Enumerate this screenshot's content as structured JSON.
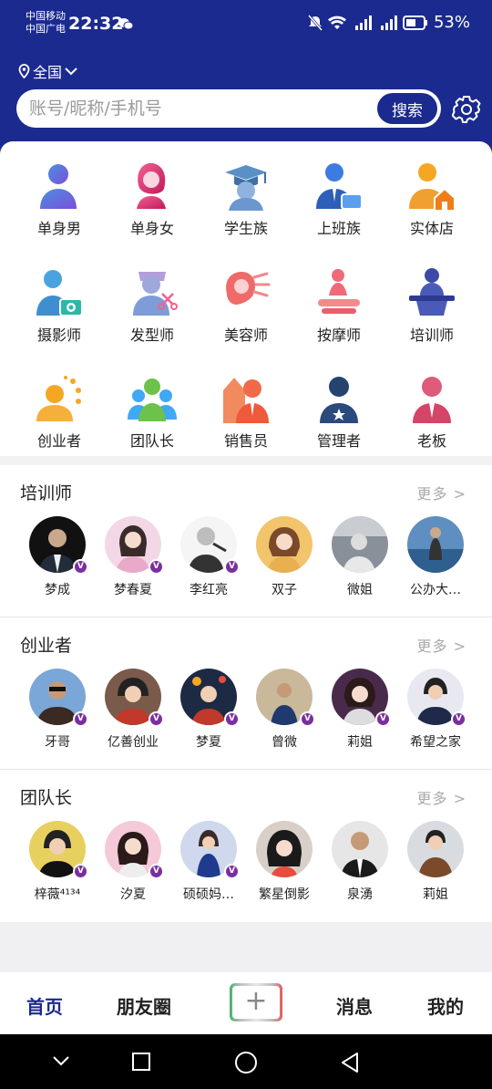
{
  "status_bar": {
    "carrier_1": "中国移动",
    "carrier_2": "中国广电",
    "time": "22:32",
    "battery": "53%"
  },
  "location": {
    "label": "全国"
  },
  "search": {
    "placeholder": "账号/昵称/手机号",
    "button": "搜索"
  },
  "categories": [
    {
      "label": "单身男",
      "icon": "single-man-icon"
    },
    {
      "label": "单身女",
      "icon": "single-woman-icon"
    },
    {
      "label": "学生族",
      "icon": "student-icon"
    },
    {
      "label": "上班族",
      "icon": "office-worker-icon"
    },
    {
      "label": "实体店",
      "icon": "store-icon"
    },
    {
      "label": "摄影师",
      "icon": "photographer-icon"
    },
    {
      "label": "发型师",
      "icon": "hairdresser-icon"
    },
    {
      "label": "美容师",
      "icon": "beautician-icon"
    },
    {
      "label": "按摩师",
      "icon": "masseur-icon"
    },
    {
      "label": "培训师",
      "icon": "trainer-icon"
    },
    {
      "label": "创业者",
      "icon": "entrepreneur-icon"
    },
    {
      "label": "团队长",
      "icon": "team-leader-icon"
    },
    {
      "label": "销售员",
      "icon": "salesperson-icon"
    },
    {
      "label": "管理者",
      "icon": "manager-icon"
    },
    {
      "label": "老板",
      "icon": "boss-icon"
    }
  ],
  "sections": [
    {
      "title": "培训师",
      "more": "更多 >",
      "people": [
        {
          "name": "梦成",
          "verified": true
        },
        {
          "name": "梦春夏",
          "verified": true
        },
        {
          "name": "李红亮",
          "verified": true
        },
        {
          "name": "双子",
          "verified": false
        },
        {
          "name": "微姐",
          "verified": false
        },
        {
          "name": "公办大…",
          "verified": false
        }
      ]
    },
    {
      "title": "创业者",
      "more": "更多 >",
      "people": [
        {
          "name": "牙哥",
          "verified": true
        },
        {
          "name": "亿善创业",
          "verified": true
        },
        {
          "name": "梦夏",
          "verified": true
        },
        {
          "name": "曾微",
          "verified": true
        },
        {
          "name": "莉姐",
          "verified": true
        },
        {
          "name": "希望之家",
          "verified": true
        }
      ]
    },
    {
      "title": "团队长",
      "more": "更多 >",
      "people": [
        {
          "name": "梓薇⁴¹³⁴",
          "verified": true
        },
        {
          "name": "汐夏",
          "verified": true
        },
        {
          "name": "硕硕妈…",
          "verified": true
        },
        {
          "name": "繁星倒影",
          "verified": false
        },
        {
          "name": "泉湧",
          "verified": false
        },
        {
          "name": "莉姐",
          "verified": false
        }
      ]
    }
  ],
  "tabbar": {
    "home": "首页",
    "moments": "朋友圈",
    "post": "+",
    "messages": "消息",
    "me": "我的"
  },
  "colors": {
    "primary": "#1b2a8e",
    "verified_badge": "#7b2f9e"
  }
}
